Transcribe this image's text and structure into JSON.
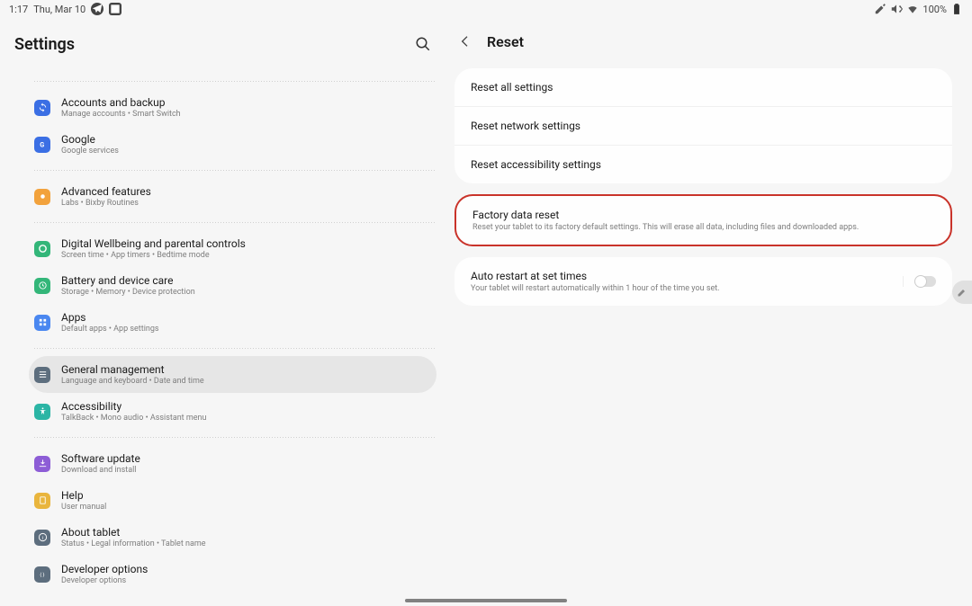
{
  "statusbar": {
    "time": "1:17",
    "date": "Thu, Mar 10",
    "battery": "100%"
  },
  "left": {
    "title": "Settings",
    "items": [
      {
        "title": "Accounts and backup",
        "sub": "Manage accounts  •  Smart Switch",
        "color": "#3b6fe4"
      },
      {
        "title": "Google",
        "sub": "Google services",
        "color": "#3b6fe4"
      },
      {
        "divider": true
      },
      {
        "title": "Advanced features",
        "sub": "Labs  •  Bixby Routines",
        "color": "#f2a23c"
      },
      {
        "divider": true
      },
      {
        "title": "Digital Wellbeing and parental controls",
        "sub": "Screen time  •  App timers  •  Bedtime mode",
        "color": "#33b679"
      },
      {
        "title": "Battery and device care",
        "sub": "Storage  •  Memory  •  Device protection",
        "color": "#33b679"
      },
      {
        "title": "Apps",
        "sub": "Default apps  •  App settings",
        "color": "#4a87f0"
      },
      {
        "divider": true
      },
      {
        "title": "General management",
        "sub": "Language and keyboard  •  Date and time",
        "color": "#5d6e7e",
        "selected": true
      },
      {
        "title": "Accessibility",
        "sub": "TalkBack  •  Mono audio  •  Assistant menu",
        "color": "#2bb5a5"
      },
      {
        "divider": true
      },
      {
        "title": "Software update",
        "sub": "Download and install",
        "color": "#8d5dd6"
      },
      {
        "title": "Help",
        "sub": "User manual",
        "color": "#e9b53d"
      },
      {
        "title": "About tablet",
        "sub": "Status  •  Legal information  •  Tablet name",
        "color": "#5d6e7e"
      },
      {
        "title": "Developer options",
        "sub": "Developer options",
        "color": "#5d6e7e"
      }
    ]
  },
  "right": {
    "title": "Reset",
    "card1": [
      {
        "title": "Reset all settings"
      },
      {
        "title": "Reset network settings"
      },
      {
        "title": "Reset accessibility settings"
      }
    ],
    "factory": {
      "title": "Factory data reset",
      "sub": "Reset your tablet to its factory default settings. This will erase all data, including files and downloaded apps."
    },
    "auto": {
      "title": "Auto restart at set times",
      "sub": "Your tablet will restart automatically within 1 hour of the time you set.",
      "enabled": false
    }
  }
}
